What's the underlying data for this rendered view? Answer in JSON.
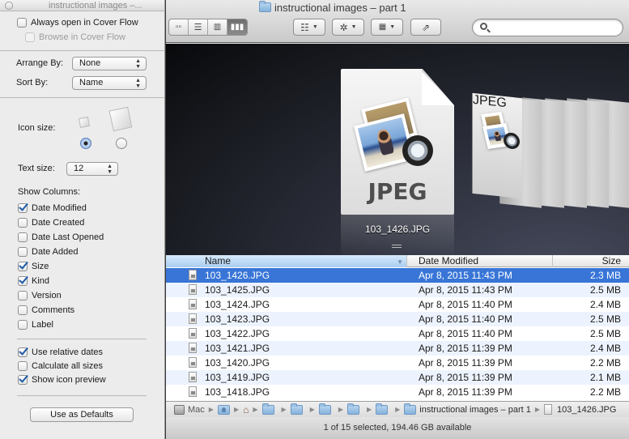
{
  "view_options": {
    "title": "instructional images –...",
    "always_open_cover_flow": {
      "label": "Always open in Cover Flow",
      "checked": false
    },
    "browse_cover_flow": {
      "label": "Browse in Cover Flow",
      "checked": false,
      "disabled": true
    },
    "arrange_by": {
      "label": "Arrange By:",
      "value": "None"
    },
    "sort_by": {
      "label": "Sort By:",
      "value": "Name"
    },
    "icon_size": {
      "label": "Icon size:",
      "selected": "small"
    },
    "text_size": {
      "label": "Text size:",
      "value": "12"
    },
    "show_columns": {
      "label": "Show Columns:",
      "items": [
        {
          "label": "Date Modified",
          "checked": true
        },
        {
          "label": "Date Created",
          "checked": false
        },
        {
          "label": "Date Last Opened",
          "checked": false
        },
        {
          "label": "Date Added",
          "checked": false
        },
        {
          "label": "Size",
          "checked": true
        },
        {
          "label": "Kind",
          "checked": true
        },
        {
          "label": "Version",
          "checked": false
        },
        {
          "label": "Comments",
          "checked": false
        },
        {
          "label": "Label",
          "checked": false
        }
      ]
    },
    "options": [
      {
        "label": "Use relative dates",
        "checked": true
      },
      {
        "label": "Calculate all sizes",
        "checked": false
      },
      {
        "label": "Show icon preview",
        "checked": true
      }
    ],
    "defaults_button": "Use as Defaults"
  },
  "finder": {
    "title": "instructional images – part 1",
    "view_modes": [
      "icon-view",
      "list-view",
      "column-view",
      "cover-flow-view"
    ],
    "active_view": "cover-flow-view",
    "search": {
      "value": "",
      "placeholder": ""
    },
    "cover_flow": {
      "selected_name": "103_1426.JPG",
      "doc_label": "JPEG"
    },
    "columns": {
      "name": "Name",
      "date": "Date Modified",
      "size": "Size"
    },
    "files": [
      {
        "name": "103_1426.JPG",
        "date": "Apr 8, 2015 11:43 PM",
        "size": "2.3 MB",
        "selected": true
      },
      {
        "name": "103_1425.JPG",
        "date": "Apr 8, 2015 11:43 PM",
        "size": "2.5 MB"
      },
      {
        "name": "103_1424.JPG",
        "date": "Apr 8, 2015 11:40 PM",
        "size": "2.4 MB"
      },
      {
        "name": "103_1423.JPG",
        "date": "Apr 8, 2015 11:40 PM",
        "size": "2.5 MB"
      },
      {
        "name": "103_1422.JPG",
        "date": "Apr 8, 2015 11:40 PM",
        "size": "2.5 MB"
      },
      {
        "name": "103_1421.JPG",
        "date": "Apr 8, 2015 11:39 PM",
        "size": "2.4 MB"
      },
      {
        "name": "103_1420.JPG",
        "date": "Apr 8, 2015 11:39 PM",
        "size": "2.2 MB"
      },
      {
        "name": "103_1419.JPG",
        "date": "Apr 8, 2015 11:39 PM",
        "size": "2.1 MB"
      },
      {
        "name": "103_1418.JPG",
        "date": "Apr 8, 2015 11:39 PM",
        "size": "2.2 MB"
      }
    ],
    "path": {
      "disk": "Mac",
      "current_folder": "instructional images – part 1",
      "file": "103_1426.JPG"
    },
    "status": "1 of 15 selected, 194.46 GB available"
  }
}
